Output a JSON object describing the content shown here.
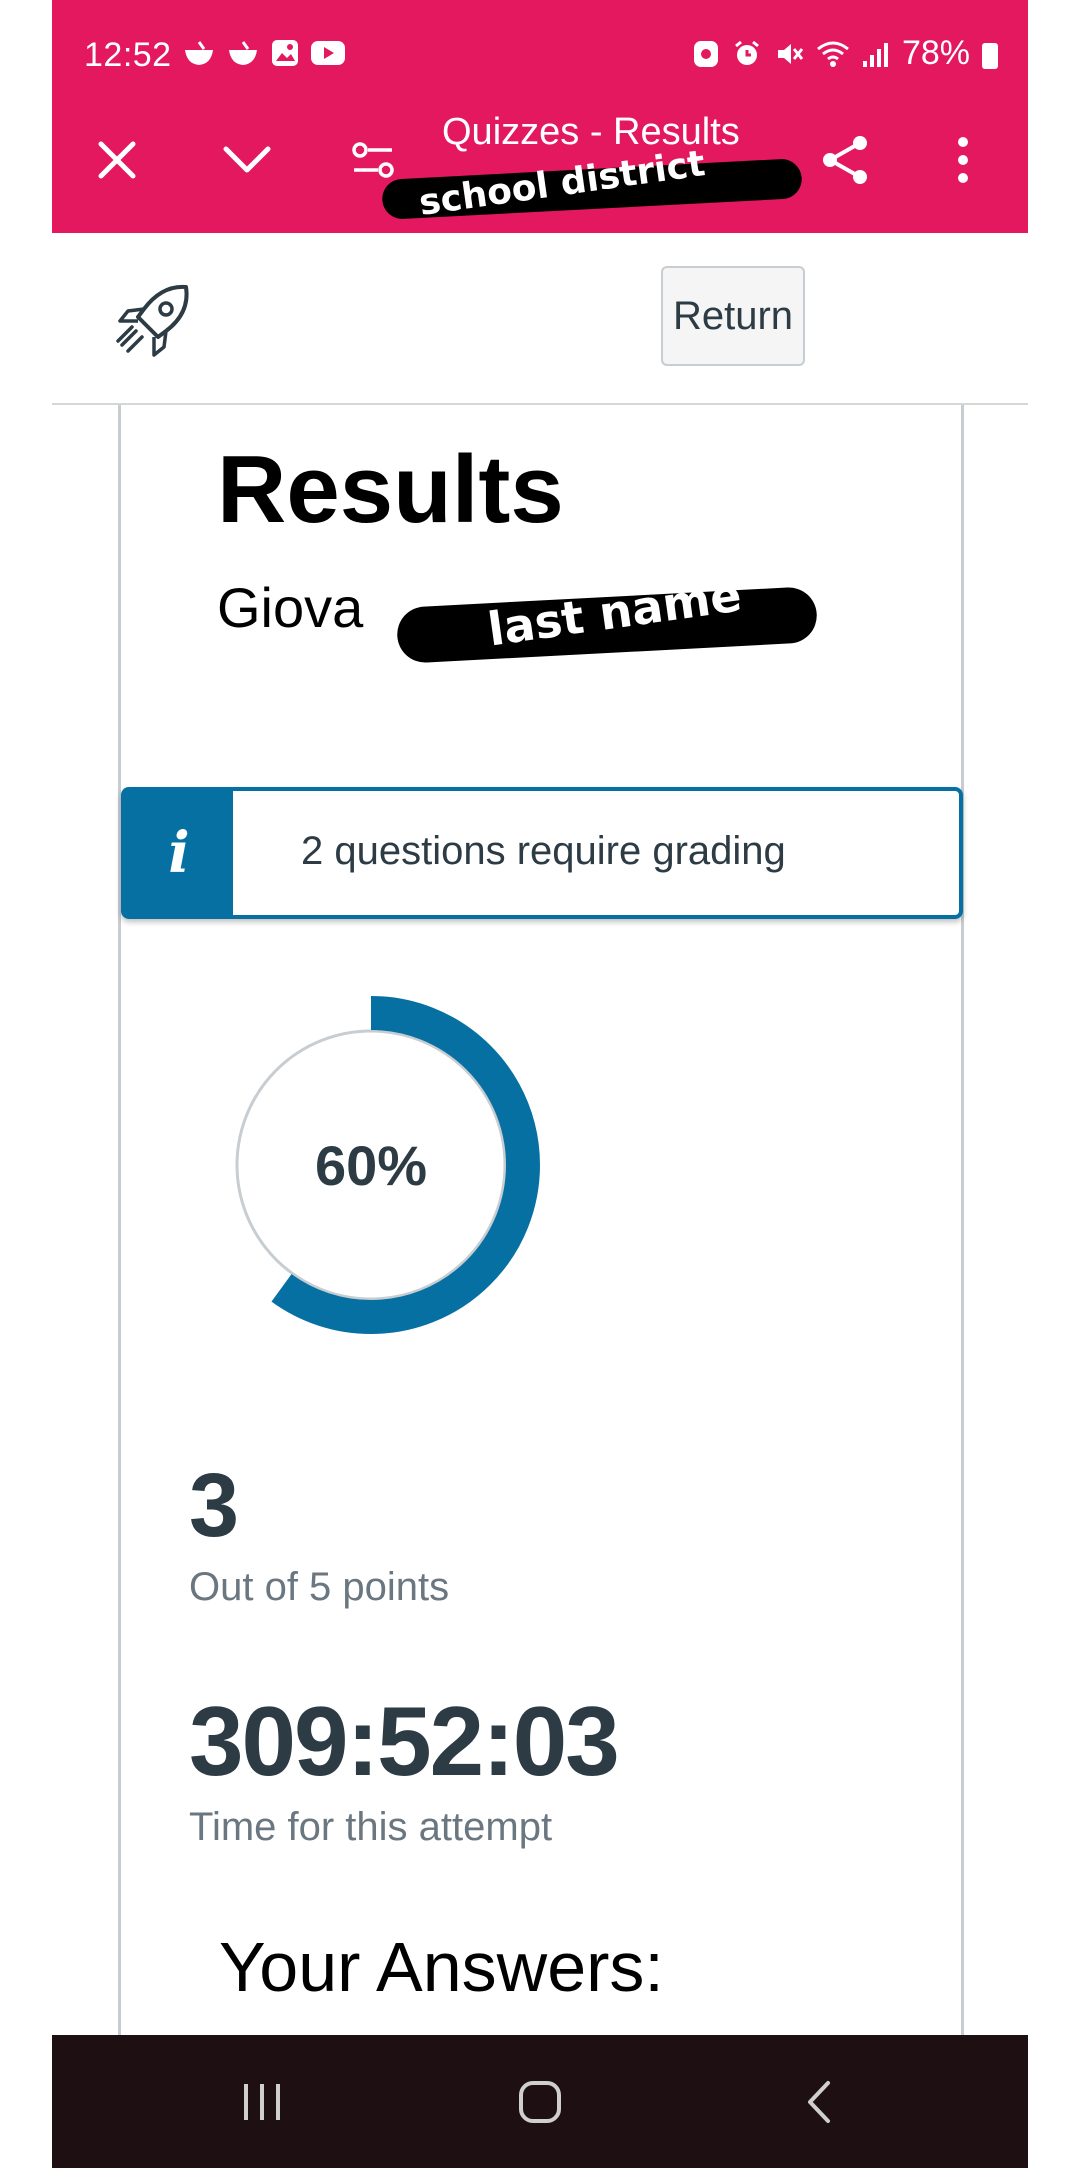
{
  "status_bar": {
    "time": "12:52",
    "battery": "78%"
  },
  "app_bar": {
    "title": "Quizzes - Results",
    "redaction_label": "school district"
  },
  "header": {
    "return_label": "Return"
  },
  "results": {
    "heading": "Results",
    "student_name_visible": "Giova",
    "redaction_label": "last name",
    "alert_icon": "i",
    "alert_text": "2 questions require grading",
    "percent_label": "60%",
    "percent_value": 60,
    "score": "3",
    "score_caption": "Out of 5 points",
    "time": "309:52:03",
    "time_caption": "Time for this attempt",
    "answers_heading": "Your Answers:"
  },
  "colors": {
    "app_bar": "#e3185f",
    "accent": "#0770a3",
    "nav_bar": "#1e1012",
    "text_dark": "#2d3b45",
    "text_muted": "#6b7780"
  },
  "icons": {
    "close": "close-icon",
    "collapse": "chevron-down-icon",
    "controls": "sliders-icon",
    "share": "share-icon",
    "more": "more-vertical-icon",
    "logo": "rocket-icon",
    "info": "info-icon",
    "recents": "recents-icon",
    "home": "home-icon",
    "back": "back-icon"
  }
}
